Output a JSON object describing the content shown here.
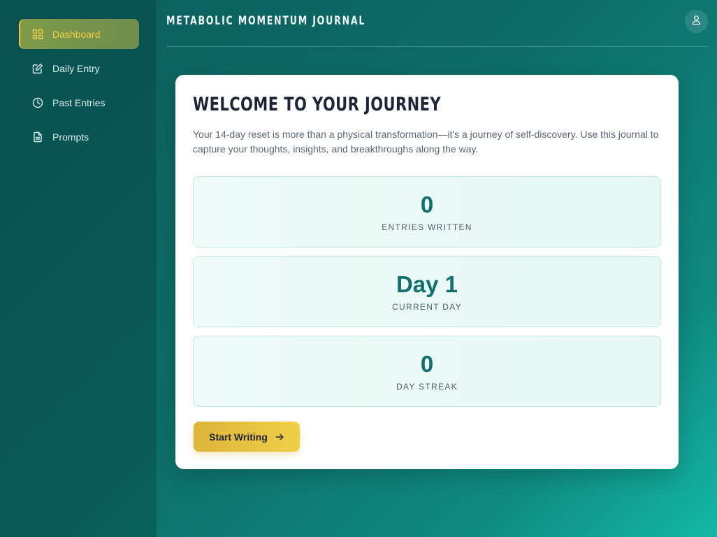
{
  "app": {
    "title": "METABOLIC MOMENTUM JOURNAL"
  },
  "sidebar": {
    "items": [
      {
        "label": "Dashboard",
        "icon": "dashboard-grid-icon",
        "active": true
      },
      {
        "label": "Daily Entry",
        "icon": "edit-icon",
        "active": false
      },
      {
        "label": "Past Entries",
        "icon": "clock-icon",
        "active": false
      },
      {
        "label": "Prompts",
        "icon": "document-icon",
        "active": false
      }
    ]
  },
  "header": {
    "avatar_icon": "user-icon"
  },
  "welcome": {
    "title": "WELCOME TO YOUR JOURNEY",
    "intro": "Your 14-day reset is more than a physical transformation—it's a journey of self-discovery. Use this journal to capture your thoughts, insights, and breakthroughs along the way."
  },
  "stats": [
    {
      "value": "0",
      "label": "ENTRIES WRITTEN"
    },
    {
      "value": "Day 1",
      "label": "CURRENT DAY"
    },
    {
      "value": "0",
      "label": "DAY STREAK"
    }
  ],
  "cta": {
    "label": "Start Writing",
    "icon": "arrow-right-icon"
  },
  "colors": {
    "accent": "#f0c843",
    "teal": "#126f6f",
    "card_bg": "#ffffff"
  }
}
